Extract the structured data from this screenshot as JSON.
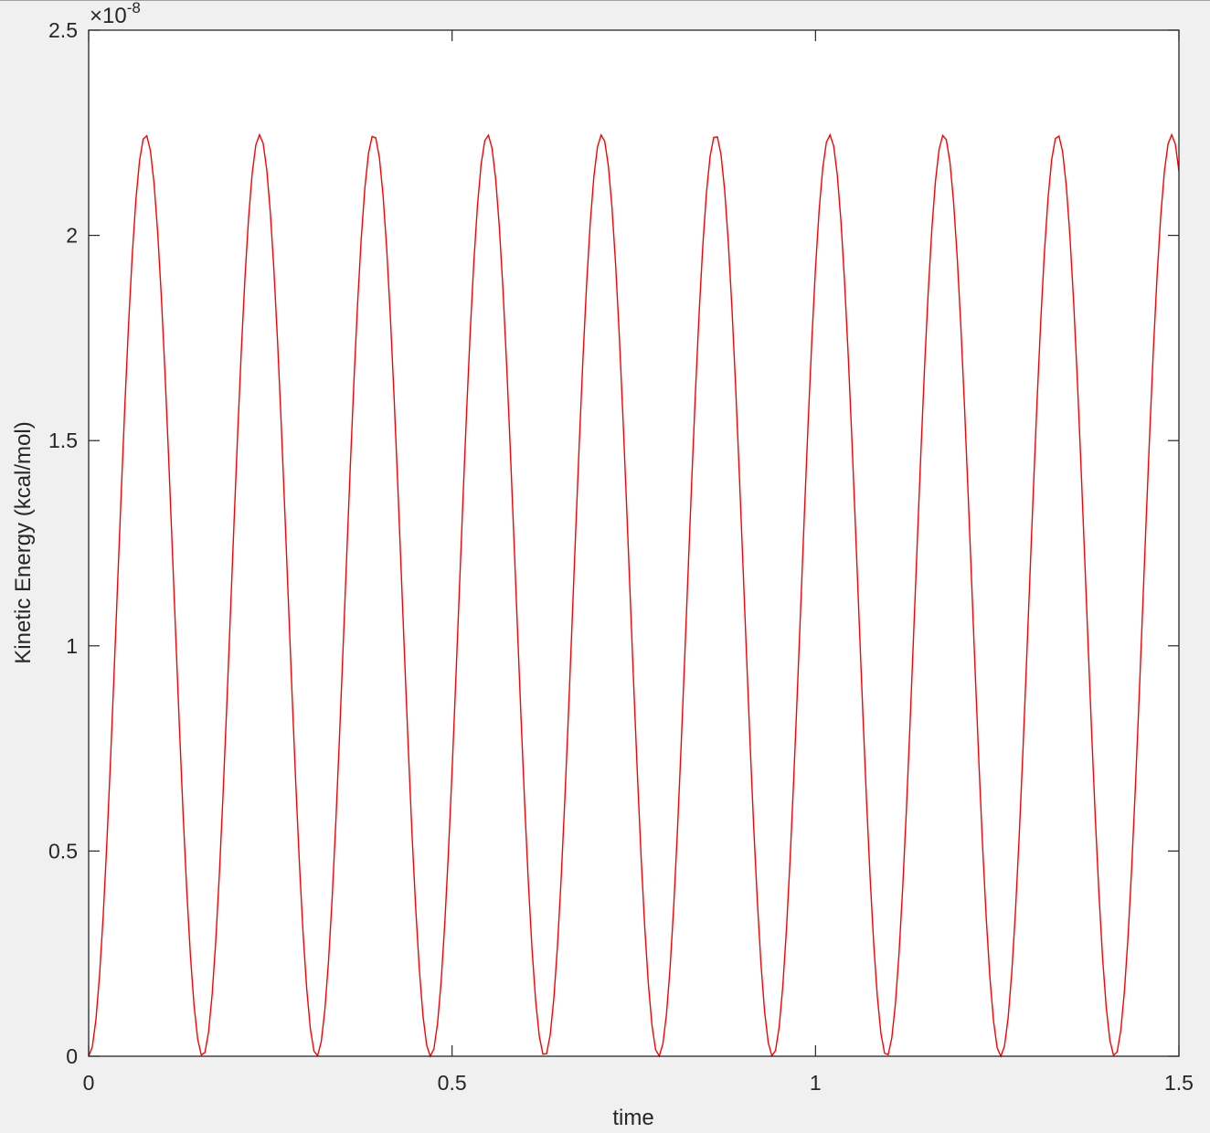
{
  "chart_data": {
    "type": "line",
    "title": "",
    "xlabel": "time",
    "ylabel": "Kinetic Energy (kcal/mol)",
    "xlim": [
      0,
      1.5
    ],
    "ylim": [
      0,
      2.5e-08
    ],
    "y_exponent_label": "×10",
    "y_exponent_power": "-8",
    "x_ticks": [
      0,
      0.5,
      1,
      1.5
    ],
    "x_tick_labels": [
      "0",
      "0.5",
      "1",
      "1.5"
    ],
    "y_ticks": [
      0,
      5e-09,
      1e-08,
      1.5e-08,
      2e-08,
      2.5e-08
    ],
    "y_tick_labels": [
      "0",
      "0.5",
      "1",
      "1.5",
      "2",
      "2.5"
    ],
    "grid": false,
    "legend": "none",
    "series": [
      {
        "name": "Kinetic Energy",
        "color": "#ff0000",
        "form": "A*sin^2(omega*t)",
        "amplitude": 2.245e-08,
        "omega": 20.03,
        "x_start": 0,
        "x_end": 1.5,
        "x_step": 0.005
      }
    ]
  }
}
